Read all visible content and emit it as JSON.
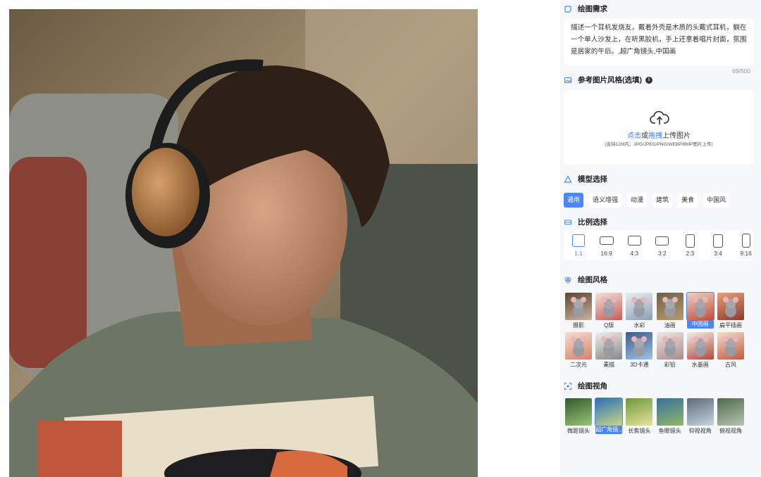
{
  "photo": {
    "alt": "man-with-wooden-headphones"
  },
  "sections": {
    "prompt": {
      "title": "绘图需求",
      "text": "描述一个耳机发烧友，戴着外壳是木质的头戴式耳机，躺在一个单人沙发上，在听黑胶机，手上还拿着唱片封面，氛围是居家的午后。,超广角镜头,中国画",
      "counter": "69/500"
    },
    "reference": {
      "title": "参考图片风格(选填)",
      "info": "i",
      "upload_click": "点击",
      "upload_or": "或",
      "upload_drag": "拖拽",
      "upload_rest": "上传图片",
      "upload_hint": "(支持12M内，JPG/JPEG/PNG/WEBP/BMP图片上传)"
    },
    "model": {
      "title": "模型选择",
      "items": [
        "通用",
        "语义增强",
        "动漫",
        "建筑",
        "美食",
        "中国风"
      ],
      "selected": "通用"
    },
    "ratio": {
      "title": "比例选择",
      "items": [
        "1:1",
        "16:9",
        "4:3",
        "3:2",
        "2:3",
        "3:4",
        "9:16"
      ],
      "selected": "1:1"
    },
    "style": {
      "title": "绘图风格",
      "items": [
        "摄影",
        "Q版",
        "水彩",
        "油画",
        "中国画",
        "扁平插画",
        "二次元",
        "素描",
        "3D卡通",
        "彩铅",
        "水墨画",
        "古风"
      ],
      "selected": "中国画"
    },
    "view": {
      "title": "绘图视角",
      "items": [
        "微距镜头",
        "超广角镜...",
        "长焦镜头",
        "鱼眼镜头",
        "仰视视角",
        "俯视视角"
      ],
      "selected": "超广角镜..."
    }
  },
  "colors": {
    "accent": "#4a86f7",
    "panel_bg": "#f5f7fa"
  }
}
